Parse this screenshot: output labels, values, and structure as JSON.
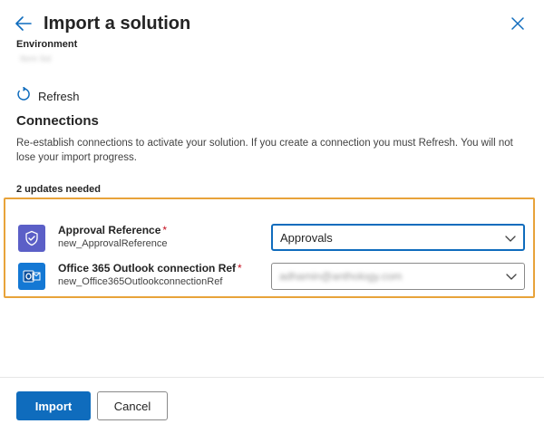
{
  "header": {
    "title": "Import a solution",
    "back_icon": "back-arrow-icon",
    "close_icon": "close-icon"
  },
  "environment": {
    "label": "Environment",
    "value": "Item list"
  },
  "refresh": {
    "label": "Refresh",
    "icon": "refresh-icon"
  },
  "connections": {
    "title": "Connections",
    "description": "Re-establish connections to activate your solution. If you create a connection you must Refresh. You will not lose your import progress.",
    "updates_needed": "2 updates needed",
    "items": [
      {
        "name": "Approval Reference",
        "required_mark": "*",
        "logical_name": "new_ApprovalReference",
        "icon": "approvals-icon",
        "selected": "Approvals"
      },
      {
        "name": "Office 365 Outlook connection Ref",
        "required_mark": "*",
        "logical_name": "new_Office365OutlookconnectionRef",
        "icon": "outlook-icon",
        "selected": "adhamin@anthology.com"
      }
    ]
  },
  "footer": {
    "import_label": "Import",
    "cancel_label": "Cancel"
  },
  "colors": {
    "accent": "#0f6cbd",
    "highlight_border": "#e8a33a",
    "approval_icon_bg": "#5b5fc7",
    "outlook_icon_bg": "#1478d4"
  }
}
